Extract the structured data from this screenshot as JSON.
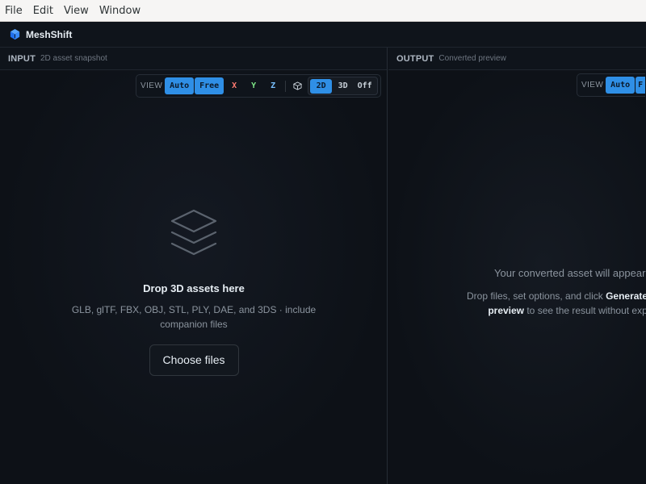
{
  "menubar": {
    "items": [
      "File",
      "Edit",
      "View",
      "Window"
    ]
  },
  "app": {
    "name": "MeshShift"
  },
  "input_panel": {
    "title": "INPUT",
    "subtitle": "2D asset snapshot",
    "toolbar": {
      "label": "VIEW",
      "auto": "Auto",
      "free": "Free",
      "x": "X",
      "y": "Y",
      "z": "Z",
      "dims": [
        "2D",
        "3D",
        "Off"
      ],
      "active_mode": "Free",
      "active_dim": "2D"
    },
    "dropzone": {
      "title": "Drop 3D assets here",
      "subtitle": "GLB, glTF, FBX, OBJ, STL, PLY, DAE, and 3DS · include companion files",
      "button": "Choose files"
    }
  },
  "output_panel": {
    "title": "OUTPUT",
    "subtitle": "Converted preview",
    "toolbar": {
      "label": "VIEW",
      "auto": "Auto",
      "free": "F"
    },
    "placeholder": {
      "title": "Your converted asset will appear",
      "line1_pre": "Drop files, set options, and click ",
      "line1_bold": "Generate",
      "line2_bold": "preview",
      "line2_post": " to see the result without exp"
    }
  },
  "colors": {
    "accent": "#2f8fe6",
    "axis_x": "#ff7b72",
    "axis_y": "#7ee787",
    "axis_z": "#79c0ff"
  },
  "icons": {
    "logo": "cube-logo-icon",
    "dropzone": "layers-icon",
    "view_cube": "cube-icon"
  }
}
